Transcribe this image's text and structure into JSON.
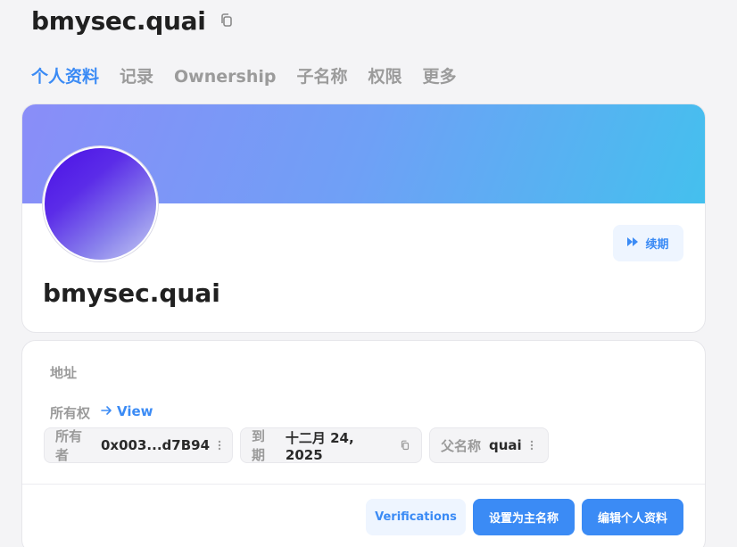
{
  "header": {
    "title": "bmysec.quai",
    "copy_icon": "copy-icon"
  },
  "tabs": [
    {
      "label": "个人资料",
      "active": true
    },
    {
      "label": "记录",
      "active": false
    },
    {
      "label": "Ownership",
      "active": false
    },
    {
      "label": "子名称",
      "active": false
    },
    {
      "label": "权限",
      "active": false
    },
    {
      "label": "更多",
      "active": false
    }
  ],
  "profile": {
    "name": "bmysec.quai",
    "renew_label": "续期",
    "renew_icon": "fast-forward-icon",
    "banner_colors": [
      "#8a8df8",
      "#44c0ee"
    ]
  },
  "info": {
    "address_label": "地址",
    "ownership_label": "所有权",
    "view_label": "View",
    "owner_label": "所有者",
    "owner_value": "0x003...d7B94",
    "expiry_label": "到期",
    "expiry_value": "十二月 24, 2025",
    "parent_label": "父名称",
    "parent_value": "quai"
  },
  "actions": {
    "verifications": "Verifications",
    "set_primary": "设置为主名称",
    "edit_profile": "编辑个人资料"
  },
  "colors": {
    "accent": "#3b8bf5",
    "background": "#f4f4f6"
  }
}
